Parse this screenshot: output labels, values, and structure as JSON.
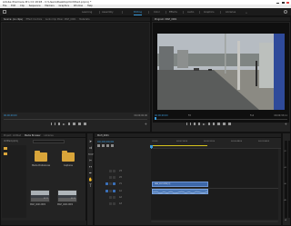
{
  "app": {
    "title": "Adobe Premiere Pro CC 2018 - C:\\Users\\Desktop\\Untitled.prproj *",
    "menu": [
      "File",
      "Edit",
      "Clip",
      "Sequence",
      "Markers",
      "Graphics",
      "Window",
      "Help"
    ]
  },
  "workspaces": [
    {
      "label": "Learning",
      "active": false
    },
    {
      "label": "Assembly",
      "active": false
    },
    {
      "label": "Editing",
      "active": true
    },
    {
      "label": "Color",
      "active": false
    },
    {
      "label": "Effects",
      "active": false
    },
    {
      "label": "Audio",
      "active": false
    },
    {
      "label": "Graphics",
      "active": false
    },
    {
      "label": "Libraries",
      "active": false
    }
  ],
  "source_panel": {
    "tabs": [
      "Source: (no clips)",
      "Effect Controls",
      "Audio Clip Mixer: MAH_0001",
      "Metadata"
    ],
    "timecode_left": "00;00;00;00",
    "timecode_right": "00;00;00;00"
  },
  "program_panel": {
    "tab": "Program: MAH_0001",
    "timecode": "00;00;00;00",
    "fit": "Fit",
    "quality": "Full",
    "duration": "00;00;33;11"
  },
  "project_panel": {
    "tabs": [
      "Project: Untitled",
      "Media Browser",
      "Libraries"
    ],
    "path": "Untitled.prproj",
    "items": [
      {
        "name": "Media Preferences",
        "type": "folder"
      },
      {
        "name": "Captures",
        "type": "folder"
      },
      {
        "name": "MAH_0001.MP4",
        "type": "clip",
        "duration": "33;11"
      },
      {
        "name": "MAH_0001.MP4",
        "type": "clip",
        "duration": "33;11"
      }
    ]
  },
  "timeline": {
    "tab": "MAH_0001",
    "timecode": "00;00;00;00",
    "ruler": [
      ";00;00",
      "00;00;16;00",
      "00;00;32;00",
      "00;00;48;00",
      "00;01;04;02"
    ],
    "tracks": [
      "V3",
      "V2",
      "V1",
      "A1",
      "A2",
      "A3"
    ],
    "video_clip": "MAH_0001.MP4 [V]",
    "meter_labels": [
      "-12",
      "-24",
      "-36",
      "-48",
      "dB"
    ]
  },
  "colors": {
    "accent": "#3a9bdc",
    "clip_video": "#3d67a8",
    "clip_audio": "#4f7bb8",
    "folder": "#d9a53a",
    "playhead": "#3a9bdc",
    "work_area": "#d8c41c"
  }
}
